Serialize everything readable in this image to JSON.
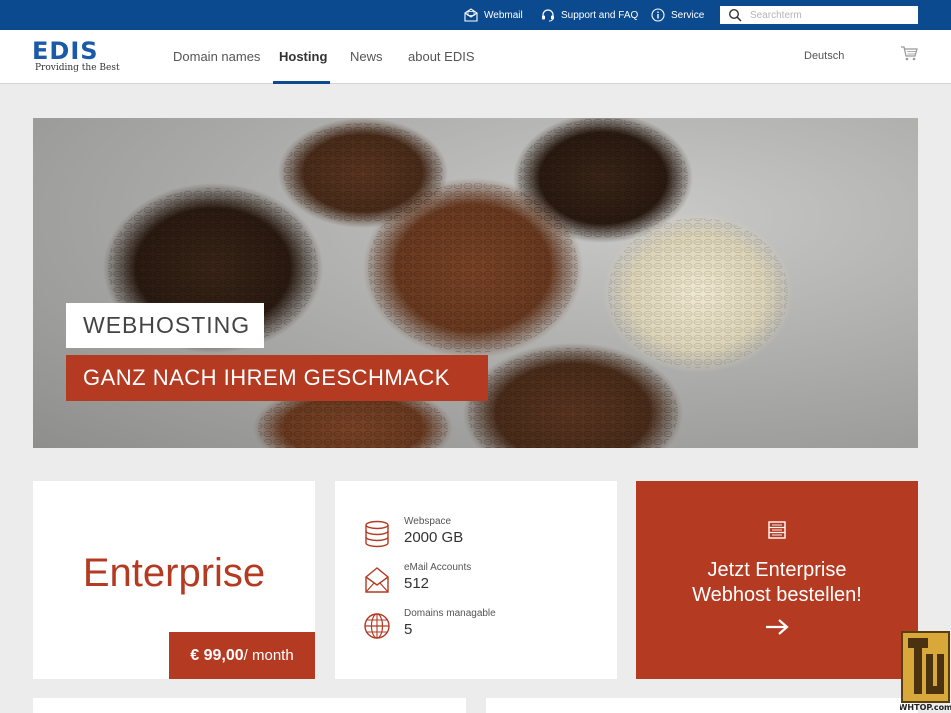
{
  "topbar": {
    "links": [
      {
        "label": "Webmail",
        "icon": "mail-icon"
      },
      {
        "label": "Support and FAQ",
        "icon": "headset-icon"
      },
      {
        "label": "Service",
        "icon": "info-icon"
      }
    ],
    "search": {
      "placeholder": "Searchterm",
      "value": ""
    }
  },
  "header": {
    "logo": {
      "word": "EDIS",
      "tagline": "Providing the Best"
    },
    "nav": [
      {
        "label": "Domain names",
        "active": false
      },
      {
        "label": "Hosting",
        "active": true
      },
      {
        "label": "News",
        "active": false
      },
      {
        "label": "about EDIS",
        "active": false
      }
    ],
    "language": "Deutsch",
    "cart_icon": "cart-icon"
  },
  "hero": {
    "tag1": "WEBHOSTING",
    "tag2": "GANZ NACH IHREM GESCHMACK",
    "image_subject": "coffee-beans"
  },
  "plan": {
    "name": "Enterprise",
    "price": "€ 99,00",
    "period": "/ month"
  },
  "features": [
    {
      "label": "Webspace",
      "value": "2000 GB",
      "icon": "database-icon"
    },
    {
      "label": "eMail Accounts",
      "value": "512",
      "icon": "envelope-icon"
    },
    {
      "label": "Domains managable",
      "value": "5",
      "icon": "globe-icon"
    }
  ],
  "cta": {
    "line1": "Jetzt Enterprise",
    "line2": "Webhost bestellen!",
    "icon": "server-icon",
    "arrow_icon": "arrow-right-icon"
  },
  "watermark": {
    "text": "WHTOP.com"
  },
  "colors": {
    "topbar": "#0b4a8f",
    "brand_blue": "#1a5aa8",
    "accent_red": "#b43a22",
    "background": "#ececec"
  }
}
